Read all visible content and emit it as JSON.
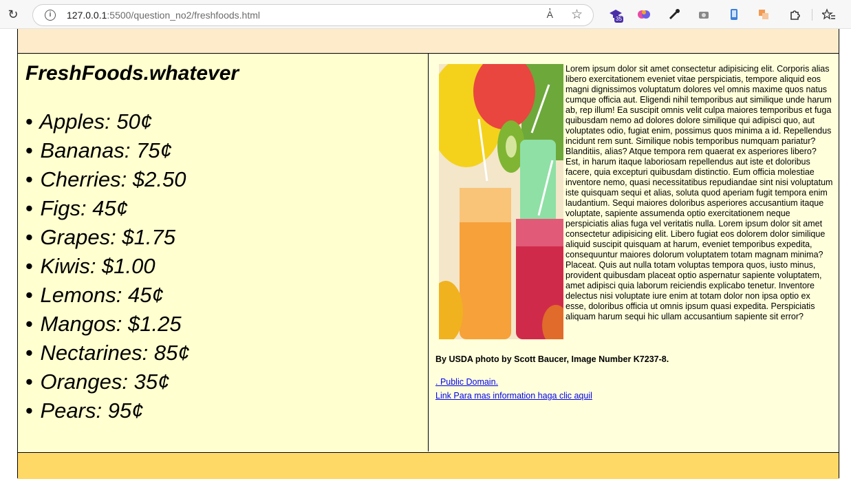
{
  "browser": {
    "url_host": "127.0.0.1",
    "url_rest": ":5500/question_no2/freshfoods.html",
    "extension_badge": "35",
    "read_aloud_label": "A̓"
  },
  "icons": [
    "reload-icon",
    "info-icon",
    "read-aloud-icon",
    "favorite-star-icon",
    "extension-graduation-icon",
    "extension-brain-icon",
    "eyedropper-icon",
    "camera-icon",
    "phone-icon",
    "translate-icon",
    "extensions-puzzle-icon",
    "favorites-list-icon"
  ],
  "page": {
    "title": "FreshFoods.whatever",
    "fruits": [
      "Apples: 50¢",
      "Bananas: 75¢",
      "Cherries: $2.50",
      "Figs: 45¢",
      "Grapes: $1.75",
      "Kiwis: $1.00",
      "Lemons: 45¢",
      "Mangos: $1.25",
      "Nectarines: 85¢",
      "Oranges: 35¢",
      "Pears: 95¢"
    ],
    "bullet": "•",
    "lorem": "Lorem ipsum dolor sit amet consectetur adipisicing elit. Corporis alias libero exercitationem eveniet vitae perspiciatis, tempore aliquid eos magni dignissimos voluptatum dolores vel omnis maxime quos natus cumque officia aut. Eligendi nihil temporibus aut similique unde harum ab, rep illum! Ea suscipit omnis velit culpa maiores temporibus et fuga quibusdam nemo ad dolores dolore similique qui adipisci quo, aut voluptates odio, fugiat enim, possimus quos minima a id. Repellendus incidunt rem sunt. Similique nobis temporibus numquam pariatur? Blanditiis, alias? Atque tempora rem quaerat ex asperiores libero? Est, in harum itaque laboriosam repellendus aut iste et doloribus facere, quia excepturi quibusdam distinctio. Eum officia molestiae inventore nemo, quasi necessitatibus repudiandae sint nisi voluptatum iste quisquam sequi et alias, soluta quod aperiam fugit tempora enim laudantium. Sequi maiores doloribus asperiores accusantium itaque voluptate, sapiente assumenda optio exercitationem neque perspiciatis alias fuga vel veritatis nulla. Lorem ipsum dolor sit amet consectetur adipisicing elit. Libero fugiat eos dolorem dolor similique aliquid suscipit quisquam at harum, eveniet temporibus expedita, consequuntur maiores dolorum voluptatem totam magnam minima? Placeat. Quis aut nulla totam voluptas tempora quos, iusto minus, provident quibusdam placeat optio aspernatur sapiente voluptatem, amet adipisci quia laborum reiciendis explicabo tenetur. Inventore delectus nisi voluptate iure enim at totam dolor non ipsa optio ex esse, doloribus officia ut omnis ipsum quasi expedita. Perspiciatis aliquam harum sequi hic ullam accusantium sapiente sit error?",
    "photo_credit": "By USDA photo by Scott Baucer, Image Number K7237-8.",
    "link_public_domain": ". Public Domain.",
    "link_more_info": "Link Para mas information haga clic aquil"
  },
  "colors": {
    "header_band": "#fdebc9",
    "left_panel": "#ffffcf",
    "right_panel": "#ffffdc",
    "footer_band": "#ffd966",
    "link": "#0000ee"
  }
}
